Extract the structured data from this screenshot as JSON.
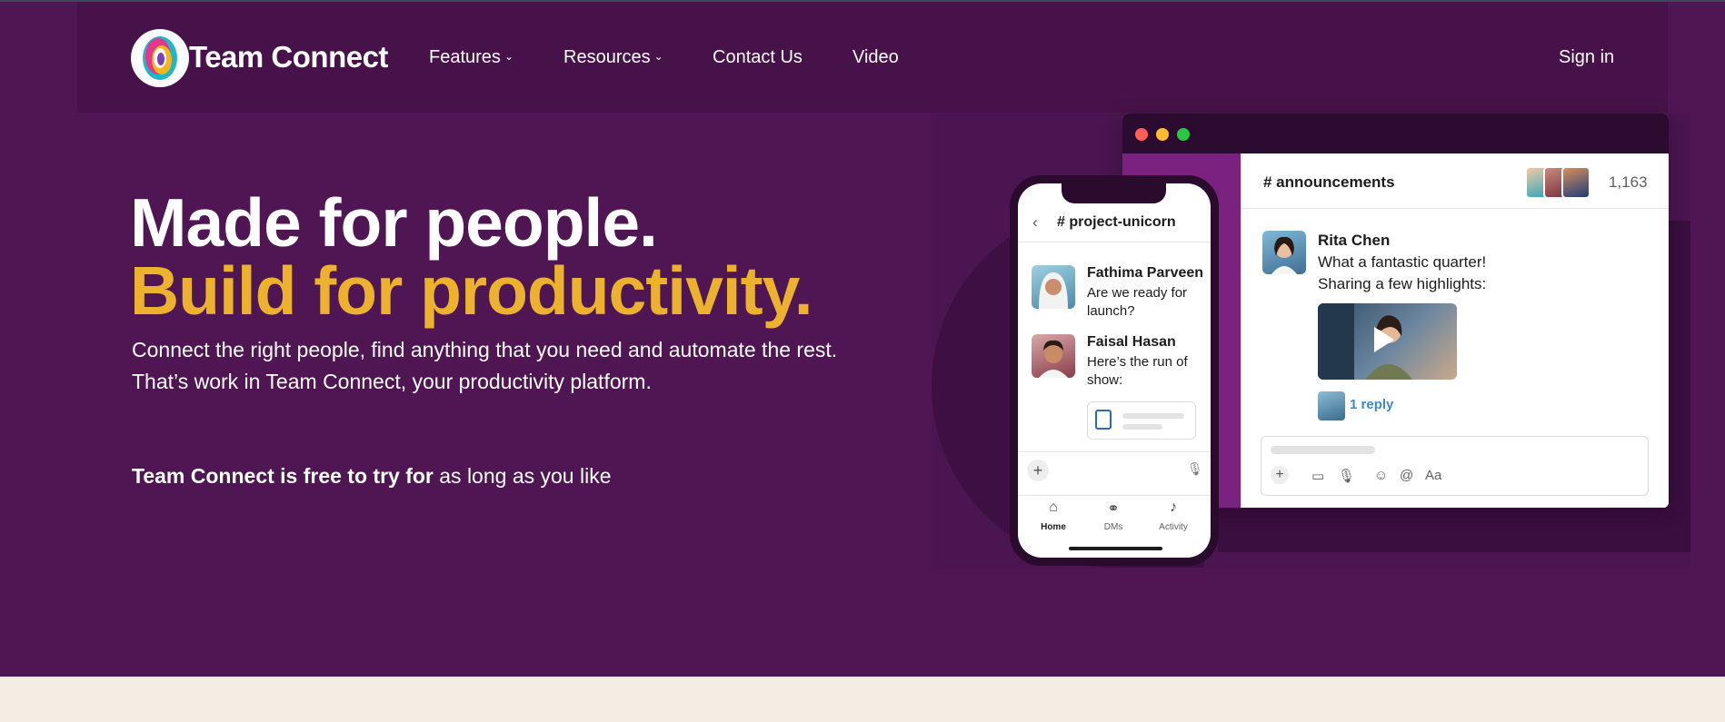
{
  "brand": {
    "name": "Team Connect"
  },
  "nav": {
    "features": "Features",
    "resources": "Resources",
    "contact": "Contact Us",
    "video": "Video",
    "signin": "Sign in"
  },
  "hero": {
    "headline_1": "Made for people.",
    "headline_2": "Build for productivity.",
    "lead": "Connect the right people, find anything that you need and automate the rest. That’s work in Team Connect, your productivity platform.",
    "free_bold": "Team Connect is free to try for",
    "free_rest": "as long as you like"
  },
  "desktop_app": {
    "channel": "# announcements",
    "member_count": "1,163",
    "message": {
      "author": "Rita Chen",
      "line_1": "What a fantastic quarter!",
      "line_2": "Sharing a few highlights:",
      "reply": "1 reply"
    },
    "composer": {
      "video": "▭",
      "mic": "🎙",
      "emoji": "☺",
      "mention": "@",
      "format": "Aa"
    }
  },
  "phone_app": {
    "channel": "# project-unicorn",
    "messages": [
      {
        "author": "Fathima Parveen",
        "text": "Are we ready for launch?"
      },
      {
        "author": "Faisal Hasan",
        "text": "Here’s the run of show:"
      }
    ],
    "tabs": {
      "home": "Home",
      "dms": "DMs",
      "activity": "Activity"
    }
  },
  "colors": {
    "hero_bg": "#4f1653",
    "accent_yellow": "#ecb22e",
    "channel_sidebar": "#7b2280"
  }
}
